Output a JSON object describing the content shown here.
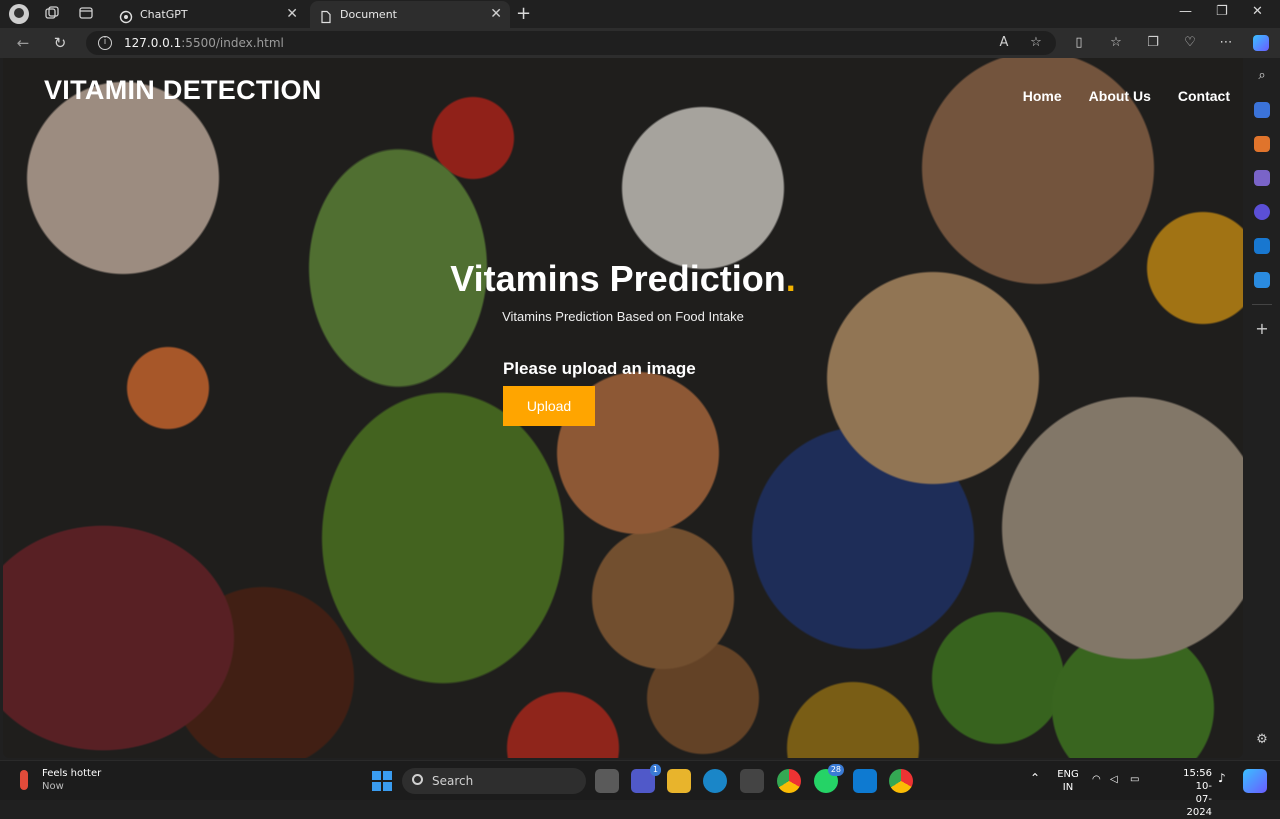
{
  "browser": {
    "tabs": [
      {
        "title": "ChatGPT",
        "active": false,
        "icon": "chatgpt-icon"
      },
      {
        "title": "Document",
        "active": true,
        "icon": "document-icon"
      }
    ],
    "address": {
      "host": "127.0.0.1",
      "path": ":5500/index.html"
    }
  },
  "site": {
    "brand": "VITAMIN DETECTION",
    "nav": [
      "Home",
      "About Us",
      "Contact"
    ],
    "hero": {
      "title": "Vitamins Prediction",
      "title_dot": ".",
      "subtitle": "Vitamins Prediction Based on Food Intake"
    },
    "upload": {
      "label": "Please upload an image",
      "button": "Upload"
    },
    "colors": {
      "accent": "#ffa500",
      "dot": "#f3b300"
    }
  },
  "taskbar": {
    "weather": {
      "title": "Feels hotter",
      "time": "Now"
    },
    "search_placeholder": "Search",
    "teams_badge": "1",
    "whatsapp_badge": "28",
    "language": {
      "lang": "ENG",
      "region": "IN"
    },
    "clock": {
      "time": "15:56",
      "date": "10-07-2024"
    }
  }
}
